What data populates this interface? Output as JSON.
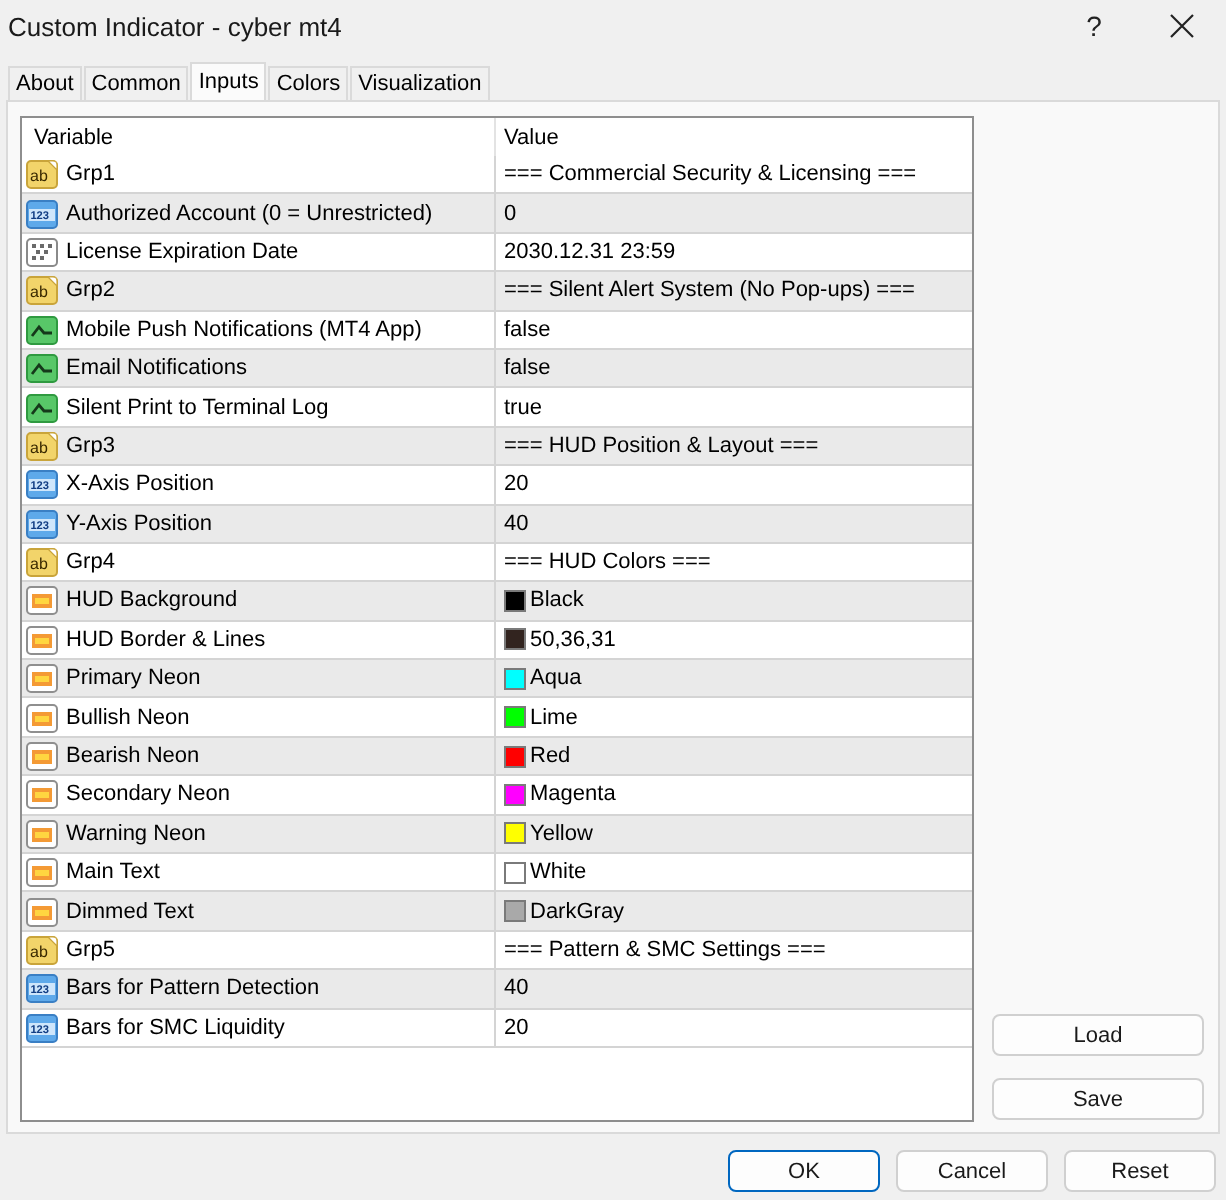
{
  "window": {
    "title": "Custom Indicator - cyber mt4",
    "help": "?"
  },
  "tabs": [
    {
      "label": "About",
      "selected": false
    },
    {
      "label": "Common",
      "selected": false
    },
    {
      "label": "Inputs",
      "selected": true
    },
    {
      "label": "Colors",
      "selected": false
    },
    {
      "label": "Visualization",
      "selected": false
    }
  ],
  "table": {
    "columns": [
      "Variable",
      "Value"
    ],
    "rows": [
      {
        "kind": "group",
        "icon_text": "ab",
        "variable": "Grp1",
        "value": "=== Commercial Security & Licensing ==="
      },
      {
        "kind": "int",
        "icon_text": "123",
        "variable": "Authorized Account (0 = Unrestricted)",
        "value": "0"
      },
      {
        "kind": "datetime",
        "variable": "License Expiration Date",
        "value": "2030.12.31 23:59"
      },
      {
        "kind": "group",
        "icon_text": "ab",
        "variable": "Grp2",
        "value": "=== Silent Alert System (No Pop-ups) ==="
      },
      {
        "kind": "bool",
        "variable": "Mobile Push Notifications (MT4 App)",
        "value": "false"
      },
      {
        "kind": "bool",
        "variable": "Email Notifications",
        "value": "false"
      },
      {
        "kind": "bool",
        "variable": "Silent Print to Terminal Log",
        "value": "true"
      },
      {
        "kind": "group",
        "icon_text": "ab",
        "variable": "Grp3",
        "value": "=== HUD Position & Layout ==="
      },
      {
        "kind": "int",
        "icon_text": "123",
        "variable": "X-Axis Position",
        "value": "20"
      },
      {
        "kind": "int",
        "icon_text": "123",
        "variable": "Y-Axis Position",
        "value": "40"
      },
      {
        "kind": "group",
        "icon_text": "ab",
        "variable": "Grp4",
        "value": "=== HUD Colors ==="
      },
      {
        "kind": "color",
        "variable": "HUD Background",
        "value": "Black",
        "color": "#000000"
      },
      {
        "kind": "color",
        "variable": "HUD Border & Lines",
        "value": "50,36,31",
        "color": "#32241f"
      },
      {
        "kind": "color",
        "variable": "Primary Neon",
        "value": "Aqua",
        "color": "#00ffff"
      },
      {
        "kind": "color",
        "variable": "Bullish Neon",
        "value": "Lime",
        "color": "#00ff00"
      },
      {
        "kind": "color",
        "variable": "Bearish Neon",
        "value": "Red",
        "color": "#ff0000"
      },
      {
        "kind": "color",
        "variable": "Secondary Neon",
        "value": "Magenta",
        "color": "#ff00ff"
      },
      {
        "kind": "color",
        "variable": "Warning Neon",
        "value": "Yellow",
        "color": "#ffff00"
      },
      {
        "kind": "color",
        "variable": "Main Text",
        "value": "White",
        "color": "#ffffff"
      },
      {
        "kind": "color",
        "variable": "Dimmed Text",
        "value": "DarkGray",
        "color": "#a9a9a9"
      },
      {
        "kind": "group",
        "icon_text": "ab",
        "variable": "Grp5",
        "value": "=== Pattern & SMC Settings ==="
      },
      {
        "kind": "int",
        "icon_text": "123",
        "variable": "Bars for Pattern Detection",
        "value": "40"
      },
      {
        "kind": "int",
        "icon_text": "123",
        "variable": "Bars for SMC Liquidity",
        "value": "20"
      }
    ]
  },
  "side_buttons": [
    "Load",
    "Save"
  ],
  "buttons": [
    {
      "label": "OK",
      "default": true
    },
    {
      "label": "Cancel",
      "default": false
    },
    {
      "label": "Reset",
      "default": false
    }
  ]
}
